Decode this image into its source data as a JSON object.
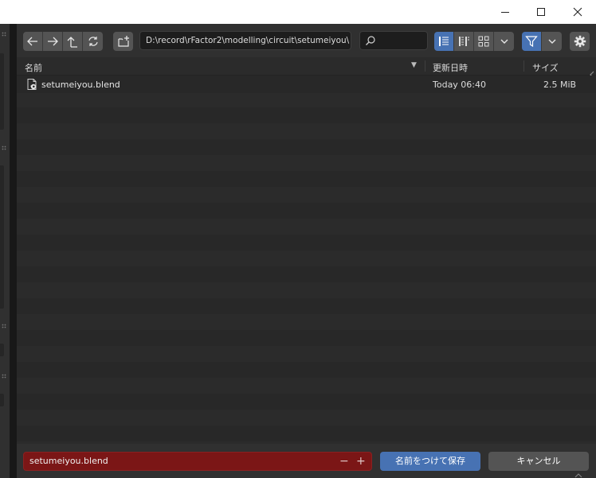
{
  "window": {
    "controls": {
      "minimize_icon": "minimize-icon",
      "maximize_icon": "maximize-icon",
      "close_icon": "close-icon"
    }
  },
  "toolbar": {
    "nav_icons": [
      "arrow-left-icon",
      "arrow-right-icon",
      "parent-directory-icon",
      "refresh-icon"
    ],
    "new_folder_icon": "new-folder-icon",
    "path": "D:\\record\\rFactor2\\modelling\\circuit\\setumeiyou\\",
    "search_value": "",
    "display_modes": [
      "vertical-list-icon",
      "horizontal-list-icon",
      "thumbnails-icon"
    ],
    "active_display_mode": "vertical-list-icon"
  },
  "columns": {
    "name": "名前",
    "modified": "更新日時",
    "size": "サイズ",
    "sort_indicator": "▼"
  },
  "files": [
    {
      "name": "setumeiyou.blend",
      "modified": "Today 06:40",
      "size": "2.5 MiB",
      "icon": "blend-file-icon"
    }
  ],
  "footer": {
    "filename": "setumeiyou.blend",
    "decrement": "−",
    "increment": "+",
    "save_label": "名前をつけて保存",
    "cancel_label": "キャンセル"
  },
  "colors": {
    "accent": "#4772b3",
    "filename_error_bg": "#7b1616",
    "panel_bg": "#303030",
    "list_bg": "#282828"
  }
}
